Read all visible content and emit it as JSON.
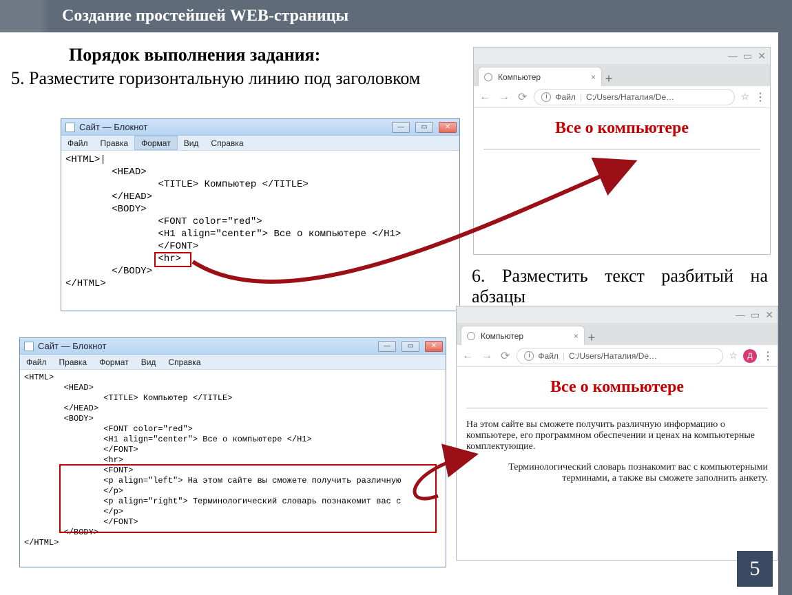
{
  "slide": {
    "title": "Создание простейшей WEB-страницы",
    "subtitle": "Порядок выполнения задания:",
    "step5": "5. Разместите горизонтальную линию под заголовком",
    "step6": "6. Разместить текст разбитый на абзацы",
    "page_num": "5"
  },
  "notepad1": {
    "title": "Сайт — Блокнот",
    "menu": [
      "Файл",
      "Правка",
      "Формат",
      "Вид",
      "Справка"
    ],
    "code": "<HTML>|\n        <HEAD>\n                <TITLE> Компьютер </TITLE>\n        </HEAD>\n        <BODY>\n                <FONT color=\"red\">\n                <H1 align=\"center\"> Все о компьютере </H1>\n                </FONT>\n                <hr>\n        </BODY>\n</HTML>"
  },
  "notepad2": {
    "title": "Сайт — Блокнот",
    "menu": [
      "Файл",
      "Правка",
      "Формат",
      "Вид",
      "Справка"
    ],
    "code": "<HTML>\n        <HEAD>\n                <TITLE> Компьютер </TITLE>\n        </HEAD>\n        <BODY>\n                <FONT color=\"red\">\n                <H1 align=\"center\"> Все о компьютере </H1>\n                </FONT>\n                <hr>\n                <FONT>\n                <p align=\"left\"> На этом сайте вы сможете получить различную \n                </p>\n                <p align=\"right\"> Терминологический словарь познакомит вас с \n                </p>\n                </FONT>\n        </BODY>\n</HTML>"
  },
  "browser_common": {
    "tab_title": "Компьютер",
    "file_prefix": "Файл",
    "path": "C:/Users/Наталия/De…",
    "avatar_letter": "Д"
  },
  "browser1": {
    "heading": "Все о компьютере"
  },
  "browser2": {
    "heading": "Все о компьютере",
    "para1": "На этом сайте вы сможете получить различную информацию о компьютере, его программном обеспечении и ценах на компьютерные комплектующие.",
    "para2": "Терминологический словарь познакомит вас с компьютерными терминами, а также вы сможете заполнить анкету."
  }
}
